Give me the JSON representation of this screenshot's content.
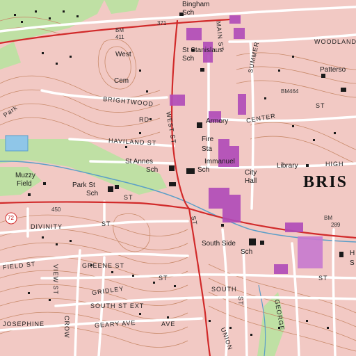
{
  "labels": {
    "bingham_school": "Bingham",
    "bingham_school2": "Sch",
    "st_stanislaus": "St Stanislaus",
    "st_stanislaus2": "Sch",
    "bm_411": "BM",
    "bm_411b": "411",
    "elev_371": "371",
    "west_cem": "West",
    "west_cem2": "Cem",
    "woodland": "WOODLAND",
    "patterson": "Patterso",
    "bm_464": "BM464",
    "summer_st": "SUMMER",
    "center": "CENTER",
    "armory": "Armory",
    "fire_sta": "Fire",
    "fire_sta2": "Sta",
    "brightwood_rd": "BRIGHTWOOD",
    "rd": "RD",
    "haviland_st": "HAVILAND ST",
    "st_annes": "St Annes",
    "st_annes2": "Sch",
    "immanuel": "Immanuel",
    "immanuel2": "Sch",
    "city_hall": "City",
    "city_hall2": "Hall",
    "library": "Library",
    "high": "HIGH",
    "bris": "BRIS",
    "muzzy_field": "Muzzy",
    "muzzy_field2": "Field",
    "park_st_sch": "Park St",
    "park_st_sch2": "Sch",
    "st_park": "ST",
    "park_label": "Park",
    "route_72": "72",
    "elev_450": "450",
    "divinity_st": "DIVINITY",
    "divinity_st2": "ST",
    "field_st": "FIELD ST",
    "greene_st": "GREENE ST",
    "view_st": "VIEW ST",
    "gridley": "GRIDLEY",
    "st_gridley": "ST",
    "south_st_ext": "SOUTH   ST   EXT",
    "south": "SOUTH",
    "geary_ave": "GEARY AVE",
    "ave": "AVE",
    "josephine": "JOSEPHINE",
    "crow": "CROW",
    "union": "UNION",
    "george": "GEORGE",
    "south_side_sch": "South Side",
    "south_side_sch2": "Sch",
    "bm_289": "BM",
    "bm_289b": "289",
    "st_main": "ST",
    "main_st": "MAIN ST",
    "west_st": "WEST ST",
    "st_label": "ST",
    "st_east": "ST",
    "st_lower": "ST",
    "st_lower2": "ST",
    "h_label": "H",
    "s_label": "S"
  },
  "colors": {
    "urban_tint": "#f2c9c4",
    "contour": "#c88a6a",
    "road_major": "#d12a2a",
    "road_minor": "#ffffff",
    "vegetation": "#bfe0a4",
    "water": "#8fc6e8",
    "building": "#1a1a1a",
    "large_building": "#b04ab8",
    "street_text": "#222222"
  }
}
